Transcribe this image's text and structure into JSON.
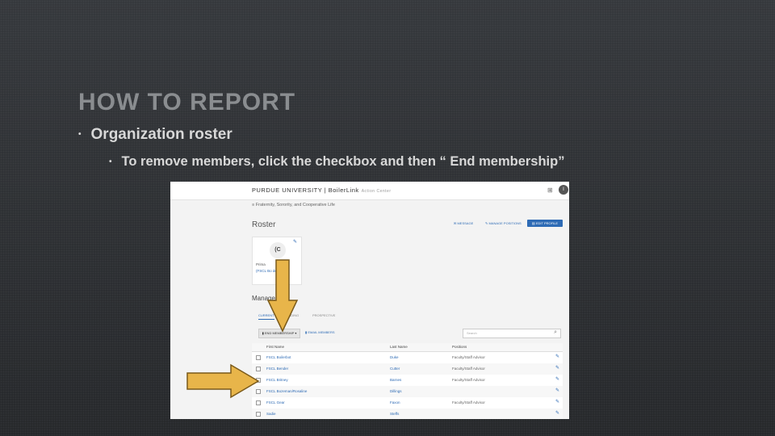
{
  "slide": {
    "title": "HOW TO REPORT",
    "bullet1": "Organization roster",
    "bullet2": "To remove members, click the checkbox and then “ End membership”",
    "accent_color": "#e8b54a"
  },
  "app": {
    "logo": "PURDUE UNIVERSITY | BoilerLink",
    "logo_sub": "Action Center",
    "avatar_letter": "I",
    "breadcrumb": "Fraternity, Sorority, and Cooperative Life",
    "page_title": "Roster",
    "toolbar": {
      "message": "MESSAGE",
      "positions": "MANAGE POSITIONS",
      "edit": "EDIT PROFILE"
    },
    "card": {
      "avatar": "(C",
      "line1": "Prima",
      "line2": "(FSCL Bo        der"
    },
    "manage_heading": "Manage",
    "tabs": [
      "CURRENT",
      "PENDING",
      "PROSPECTIVE"
    ],
    "end_button": "END MEMBERSHIP",
    "email_button": "EMAIL MEMBERS",
    "search_placeholder": "Search",
    "columns": [
      "First Name",
      "Last Name",
      "Positions"
    ],
    "rows": [
      {
        "first": "FSCL Boilerbot",
        "last": "Duke",
        "pos": "Faculty/Staff Advisor"
      },
      {
        "first": "FSCL Bender",
        "last": "Cutter",
        "pos": "Faculty/Staff Advisor"
      },
      {
        "first": "FSCL Britney",
        "last": "Barnes",
        "pos": "Faculty/Staff Advisor"
      },
      {
        "first": "FSCL Bozeman/Rosaline",
        "last": "Dillings",
        "pos": ""
      },
      {
        "first": "FSCL Gear",
        "last": "Faxon",
        "pos": "Faculty/Staff Advisor"
      },
      {
        "first": "Sadie",
        "last": "Steffs",
        "pos": ""
      }
    ]
  }
}
